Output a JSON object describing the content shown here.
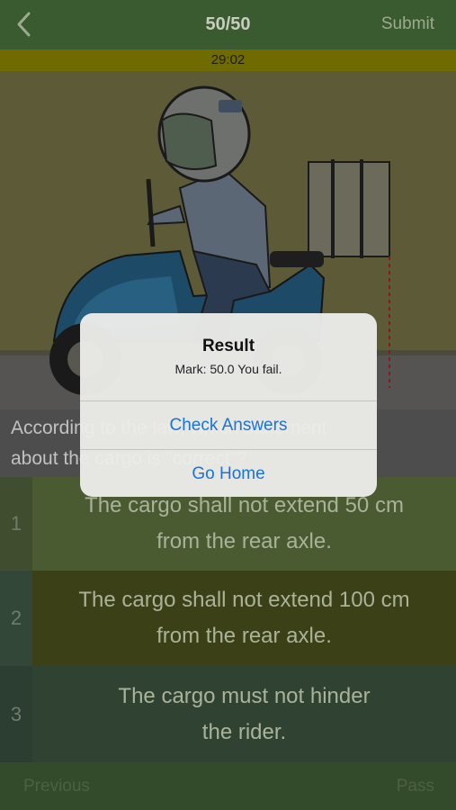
{
  "nav": {
    "back_icon": "chevron-left-icon",
    "progress": "50/50",
    "submit_label": "Submit"
  },
  "timer": "29:02",
  "question": {
    "line1": "According to the law, which statement",
    "line2": "about the cargo is “correct”?"
  },
  "options": [
    {
      "number": "1",
      "line1": "The cargo shall not extend 50 cm",
      "line2": "from the rear axle."
    },
    {
      "number": "2",
      "line1": "The cargo shall not extend 100 cm",
      "line2": "from the rear axle."
    },
    {
      "number": "3",
      "line1": "The cargo must not hinder",
      "line2": "the rider."
    }
  ],
  "bottom": {
    "previous_label": "Previous",
    "pass_label": "Pass"
  },
  "dialog": {
    "title": "Result",
    "message": "Mark: 50.0 You fail.",
    "check_answers_label": "Check Answers",
    "go_home_label": "Go Home"
  },
  "colors": {
    "nav_bg": "#3a5a30",
    "timer_bg": "#6f6b00",
    "dialog_button": "#1a73d9"
  }
}
